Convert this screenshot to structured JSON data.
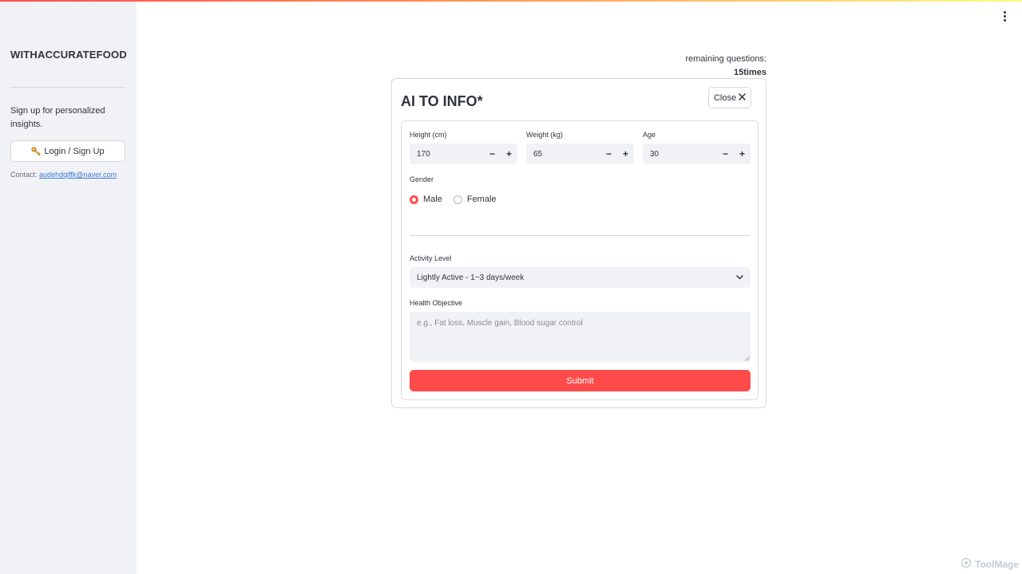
{
  "sidebar": {
    "brand": "WITHACCURATEFOOD",
    "signup_text": "Sign up for personalized insights.",
    "login_label": "Login / Sign Up",
    "contact_label": "Contact:",
    "contact_email": "audehdqlffk@naver.com"
  },
  "header": {
    "remaining_label": "remaining questions:",
    "remaining_count": "15times"
  },
  "dialog": {
    "title": "AI TO INFO*",
    "close_label": "Close",
    "fields": {
      "height": {
        "label": "Height (cm)",
        "value": "170"
      },
      "weight": {
        "label": "Weight (kg)",
        "value": "65"
      },
      "age": {
        "label": "Age",
        "value": "30"
      }
    },
    "gender": {
      "label": "Gender",
      "options": [
        "Male",
        "Female"
      ],
      "selected": "Male"
    },
    "activity": {
      "label": "Activity Level",
      "selected": "Lightly Active - 1~3 days/week"
    },
    "objective": {
      "label": "Health Objective",
      "placeholder": "e.g., Fat loss, Muscle gain, Blood sugar control"
    },
    "submit_label": "Submit"
  },
  "watermark": "ToolMage",
  "colors": {
    "accent": "#ff4b4b",
    "sidebar_bg": "#f0f2f6",
    "input_bg": "#f0f2f6"
  }
}
